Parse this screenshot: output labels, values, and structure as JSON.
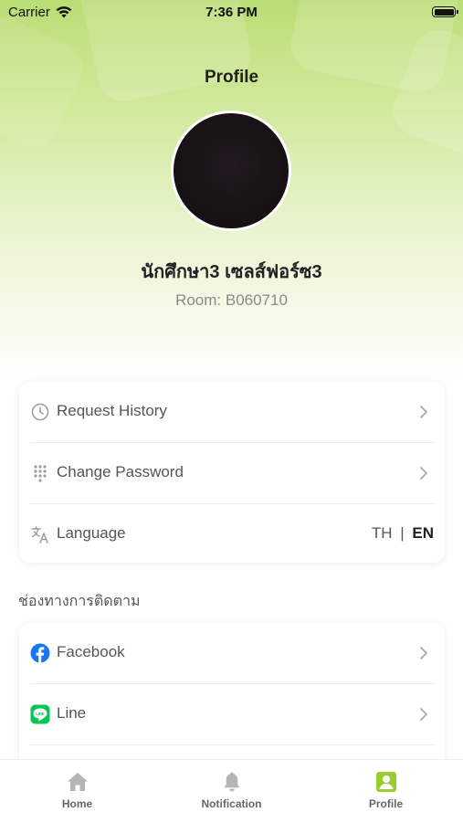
{
  "status_bar": {
    "carrier": "Carrier",
    "time": "7:36 PM"
  },
  "header": {
    "title": "Profile"
  },
  "profile": {
    "name": "นักศึกษา3 เซลส์ฟอร์ซ3",
    "room": "Room: B060710"
  },
  "menu": [
    {
      "label": "Request History",
      "icon": "clock-icon"
    },
    {
      "label": "Change Password",
      "icon": "keypad-icon"
    },
    {
      "label": "Language",
      "icon": "translate-icon"
    }
  ],
  "language": {
    "th": "TH",
    "separator": "|",
    "en": "EN",
    "selected": "EN"
  },
  "follow": {
    "title": "ช่องทางการติดตาม",
    "items": [
      {
        "label": "Facebook",
        "icon": "facebook-icon",
        "color": "#1877F2"
      },
      {
        "label": "Line",
        "icon": "line-icon",
        "color": "#06C755"
      }
    ]
  },
  "tabs": [
    {
      "label": "Home",
      "icon": "home-icon"
    },
    {
      "label": "Notification",
      "icon": "bell-icon"
    },
    {
      "label": "Profile",
      "icon": "profile-icon",
      "active": true
    }
  ],
  "colors": {
    "accent": "#9ACD32",
    "muted": "#8a8a8a",
    "tab_inactive": "#b5b5b5"
  }
}
